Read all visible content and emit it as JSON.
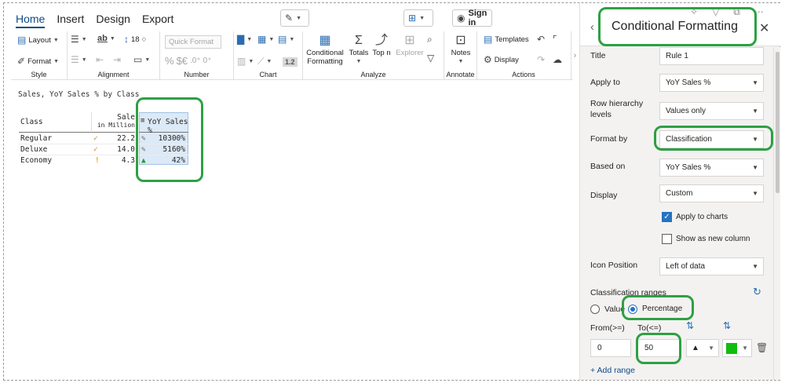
{
  "ribbon": {
    "tabs": [
      "Home",
      "Insert",
      "Design",
      "Export"
    ],
    "active_tab": "Home",
    "sign_in_label": "Sign in",
    "groups": {
      "style": {
        "label": "Style",
        "layout": "Layout",
        "format": "Format"
      },
      "alignment": {
        "label": "Alignment",
        "font_size": "18"
      },
      "number": {
        "label": "Number",
        "quick_format": "Quick Format",
        "currency": "$€",
        "dec_up": ".0⁺",
        "dec_down": "0⁺",
        "pct": "%"
      },
      "chart": {
        "label": "Chart",
        "value_pill": "1.2"
      },
      "analyze": {
        "label": "Analyze",
        "conditional_formatting": "Conditional Formatting",
        "totals": "Totals",
        "top_n": "Top n",
        "explorer": "Explorer"
      },
      "annotate": {
        "label": "Annotate",
        "notes": "Notes"
      },
      "actions": {
        "label": "Actions",
        "templates": "Templates",
        "display": "Display"
      }
    }
  },
  "table": {
    "title": "Sales, YoY Sales % by Class",
    "headers": {
      "class": "Class",
      "sales": "Sale",
      "sales_sub": "in Million",
      "yoy": "YoY Sales %"
    },
    "rows": [
      {
        "class": "Regular",
        "sales_icon": "✓",
        "sales": "22.2",
        "yoy_icon": "pencil",
        "yoy": "10300%"
      },
      {
        "class": "Deluxe",
        "sales_icon": "✓",
        "sales": "14.0",
        "yoy_icon": "pencil",
        "yoy": "5160%"
      },
      {
        "class": "Economy",
        "sales_icon": "!",
        "sales": "4.3",
        "yoy_icon": "up-triangle",
        "yoy": "42%"
      }
    ]
  },
  "panel": {
    "title": "Conditional Formatting",
    "fields": {
      "title": {
        "label": "Title",
        "value": "Rule 1"
      },
      "apply_to": {
        "label": "Apply to",
        "value": "YoY Sales %"
      },
      "row_hierarchy": {
        "label": "Row hierarchy levels",
        "value": "Values only"
      },
      "format_by": {
        "label": "Format by",
        "value": "Classification"
      },
      "based_on": {
        "label": "Based on",
        "value": "YoY Sales %"
      },
      "display": {
        "label": "Display",
        "value": "Custom"
      },
      "icon_position": {
        "label": "Icon Position",
        "value": "Left of data"
      }
    },
    "apply_to_charts": {
      "label": "Apply to charts",
      "checked": true
    },
    "show_new_column": {
      "label": "Show as new column",
      "checked": false
    },
    "classification": {
      "label": "Classification ranges",
      "value_option": "Value",
      "percentage_option": "Percentage",
      "selected": "Percentage",
      "from_label": "From(>=)",
      "to_label": "To(<=)",
      "from": "0",
      "to": "50",
      "icon": "▲",
      "color": "#0fbd0f"
    },
    "add_range": "+ Add range"
  },
  "colors": {
    "accent": "#0f4a85",
    "annotation": "#2ea043"
  }
}
